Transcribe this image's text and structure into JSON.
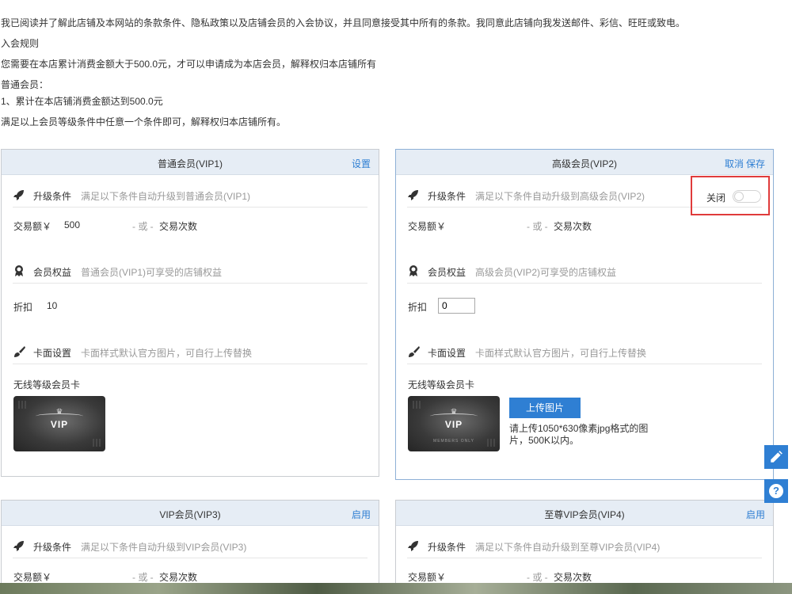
{
  "intro": {
    "agreement": "我已阅读并了解此店铺及本网站的条款条件、隐私政策以及店铺会员的入会协议，并且同意接受其中所有的条款。我同意此店铺向我发送邮件、彩信、旺旺或致电。",
    "rules_title": "入会规则",
    "rules_text": "您需要在本店累计消费金额大于500.0元，才可以申请成为本店会员，解释权归本店铺所有",
    "normal_member": "普通会员：",
    "condition_1": "1、累计在本店铺消费金额达到500.0元",
    "footer": "满足以上会员等级条件中任意一个条件即可，解释权归本店铺所有。"
  },
  "labels": {
    "upgrade": "升级条件",
    "benefits": "会员权益",
    "card_setting": "卡面设置",
    "card_desc": "卡面样式默认官方图片，可自行上传替换",
    "trade_amount": "交易额￥",
    "or": "- 或 -",
    "trade_count": "交易次数",
    "discount": "折扣",
    "wireless_card": "无线等级会员卡",
    "card_text": "VIP",
    "card_sub": "MEMBERS ONLY"
  },
  "vip1": {
    "title": "普通会员(VIP1)",
    "action": "设置",
    "upgrade_desc": "满足以下条件自动升级到普通会员(VIP1)",
    "benefit_desc": "普通会员(VIP1)可享受的店铺权益",
    "amount": "500",
    "discount": "10"
  },
  "vip2": {
    "title": "高级会员(VIP2)",
    "cancel": "取消",
    "save": "保存",
    "upgrade_desc": "满足以下条件自动升级到高级会员(VIP2)",
    "toggle_label": "关闭",
    "toggle_on": false,
    "benefit_desc": "高级会员(VIP2)可享受的店铺权益",
    "discount_value": "0",
    "upload_button": "上传图片",
    "upload_hint": "请上传1050*630像素jpg格式的图片，500K以内。"
  },
  "vip3": {
    "title": "VIP会员(VIP3)",
    "action": "启用",
    "upgrade_desc": "满足以下条件自动升级到VIP会员(VIP3)"
  },
  "vip4": {
    "title": "至尊VIP会员(VIP4)",
    "action": "启用",
    "upgrade_desc": "满足以下条件自动升级到至尊VIP会员(VIP4)"
  },
  "colors": {
    "accent": "#2f7fd3",
    "highlight": "#e03b3b",
    "header_bg": "#e6edf5"
  },
  "icons": [
    "rocket-icon",
    "medal-icon",
    "brush-icon",
    "edit-icon",
    "help-icon"
  ]
}
